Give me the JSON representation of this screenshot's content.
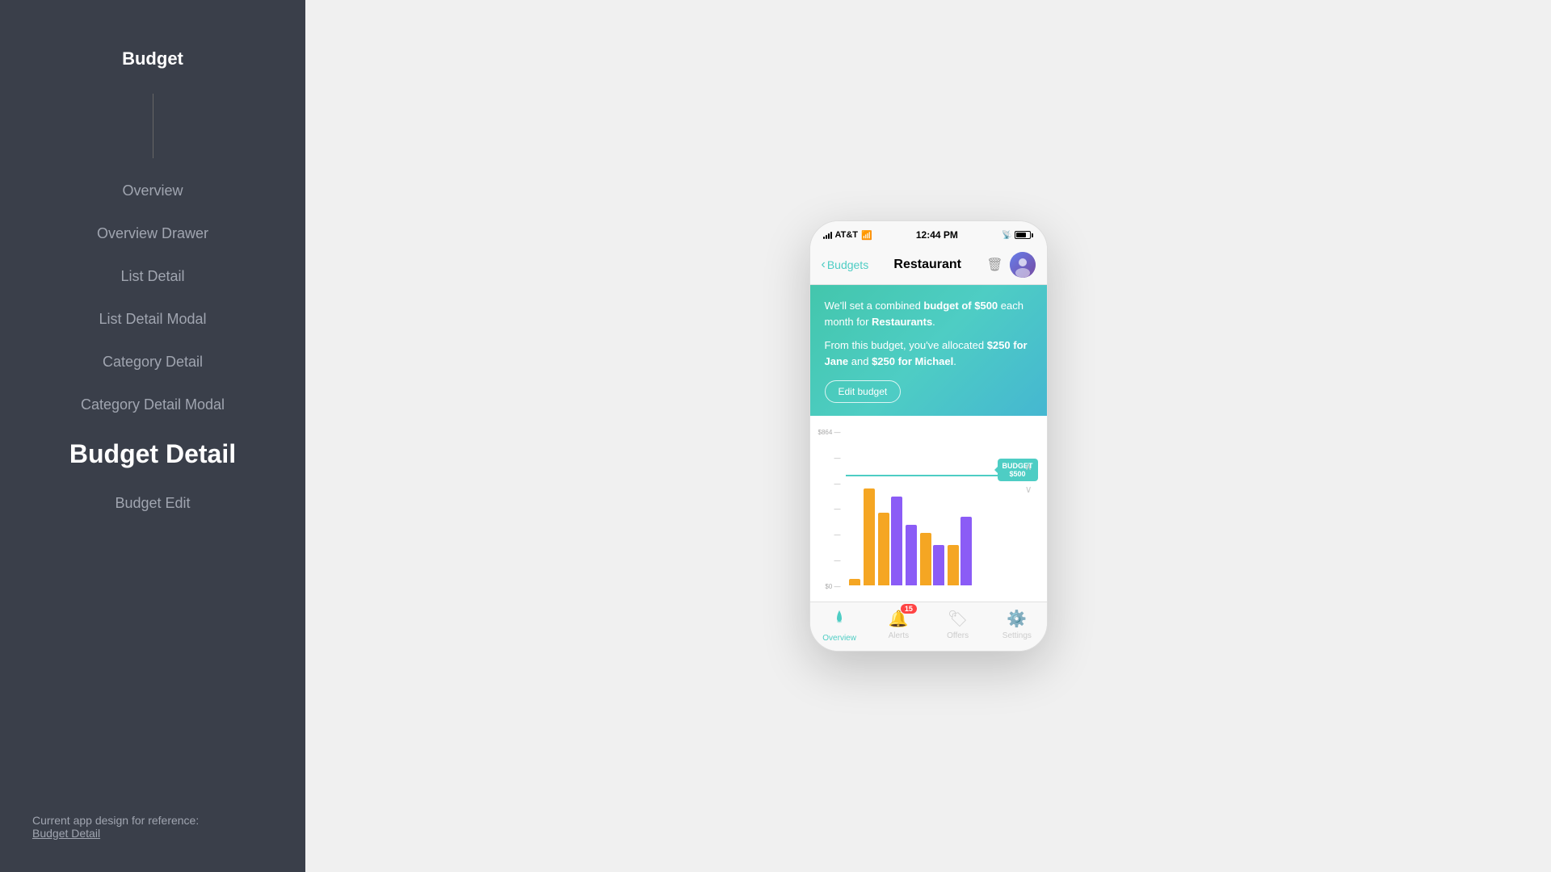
{
  "sidebar": {
    "title": "Budget",
    "nav_items": [
      {
        "id": "overview",
        "label": "Overview",
        "active": false
      },
      {
        "id": "overview-drawer",
        "label": "Overview Drawer",
        "active": false
      },
      {
        "id": "list-detail",
        "label": "List Detail",
        "active": false
      },
      {
        "id": "list-detail-modal",
        "label": "List Detail Modal",
        "active": false
      },
      {
        "id": "category-detail",
        "label": "Category Detail",
        "active": false
      },
      {
        "id": "category-detail-modal",
        "label": "Category Detail Modal",
        "active": false
      },
      {
        "id": "budget-detail",
        "label": "Budget Detail",
        "active": true
      },
      {
        "id": "budget-edit",
        "label": "Budget Edit",
        "active": false
      }
    ],
    "footer_text": "Current app design for reference:",
    "footer_link": "Budget Detail"
  },
  "phone": {
    "status_bar": {
      "carrier": "AT&T",
      "time": "12:44 PM"
    },
    "nav": {
      "back_label": "Budgets",
      "title": "Restaurant",
      "avatar_initial": "👤"
    },
    "banner": {
      "line1_prefix": "We'll set a combined ",
      "line1_bold": "budget of $500",
      "line1_suffix": " each month for ",
      "line1_bold2": "Restaurants",
      "line1_end": ".",
      "line2_prefix": "From this budget, you've allocated ",
      "line2_bold1": "$250 for Jane",
      "line2_mid": " and ",
      "line2_bold2": "$250 for Michael",
      "line2_end": ".",
      "button": "Edit budget"
    },
    "chart": {
      "y_labels": [
        "$864 —",
        "—",
        "—",
        "—",
        "—",
        "—",
        "$0 —"
      ],
      "budget_line_label1": "BUDGET",
      "budget_line_label2": "$500",
      "bars": [
        {
          "orange": 5,
          "purple": 0
        },
        {
          "orange": 100,
          "purple": 0
        },
        {
          "orange": 75,
          "purple": 90
        },
        {
          "orange": 0,
          "purple": 60
        },
        {
          "orange": 55,
          "purple": 40
        },
        {
          "orange": 40,
          "purple": 70
        }
      ]
    },
    "tabs": [
      {
        "id": "overview",
        "label": "Overview",
        "icon": "💧",
        "active": true,
        "badge": null
      },
      {
        "id": "alerts",
        "label": "Alerts",
        "icon": "🔔",
        "active": false,
        "badge": "15"
      },
      {
        "id": "offers",
        "label": "Offers",
        "icon": "🏷",
        "active": false,
        "badge": null
      },
      {
        "id": "settings",
        "label": "Settings",
        "icon": "⚙️",
        "active": false,
        "badge": null
      }
    ]
  }
}
